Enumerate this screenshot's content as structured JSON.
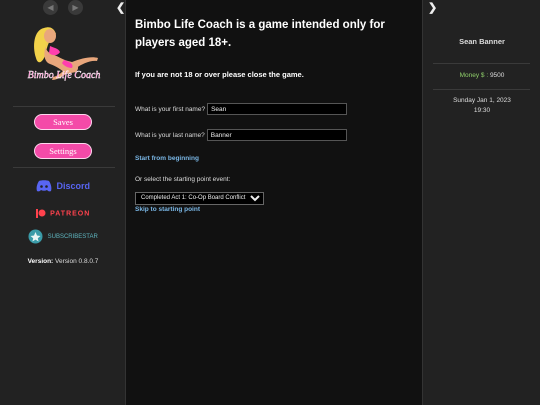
{
  "sidebar": {
    "logo_text": "Bimbo Life Coach",
    "saves_label": "Saves",
    "settings_label": "Settings",
    "discord_label": "Discord",
    "patreon_label": "PATREON",
    "subscribestar_label": "SUBSCRIBESTAR",
    "version_label": "Version:",
    "version_value": "Version 0.8.0.7"
  },
  "passage": {
    "title": "Bimbo Life Coach is a game intended only for players aged 18+.",
    "warning": "If you are not 18 or over please close the game.",
    "first_name_label": "What is your first name?",
    "first_name_value": "Sean",
    "last_name_label": "What is your last name?",
    "last_name_value": "Banner",
    "start_link": "Start from beginning",
    "select_label": "Or select the starting point event:",
    "select_value": "Completed Act 1: Co-Op Board Conflict",
    "skip_link": "Skip to starting point"
  },
  "status": {
    "name": "Sean Banner",
    "money_label": "Money $ :",
    "money_value": "9500",
    "date": "Sunday Jan 1, 2023",
    "time": "19:30"
  },
  "colors": {
    "accent_pink": "#f44aa8",
    "link_blue": "#7ab7e6",
    "money_green": "#8fcf6a",
    "discord": "#5865f2",
    "patreon": "#ff424d"
  }
}
